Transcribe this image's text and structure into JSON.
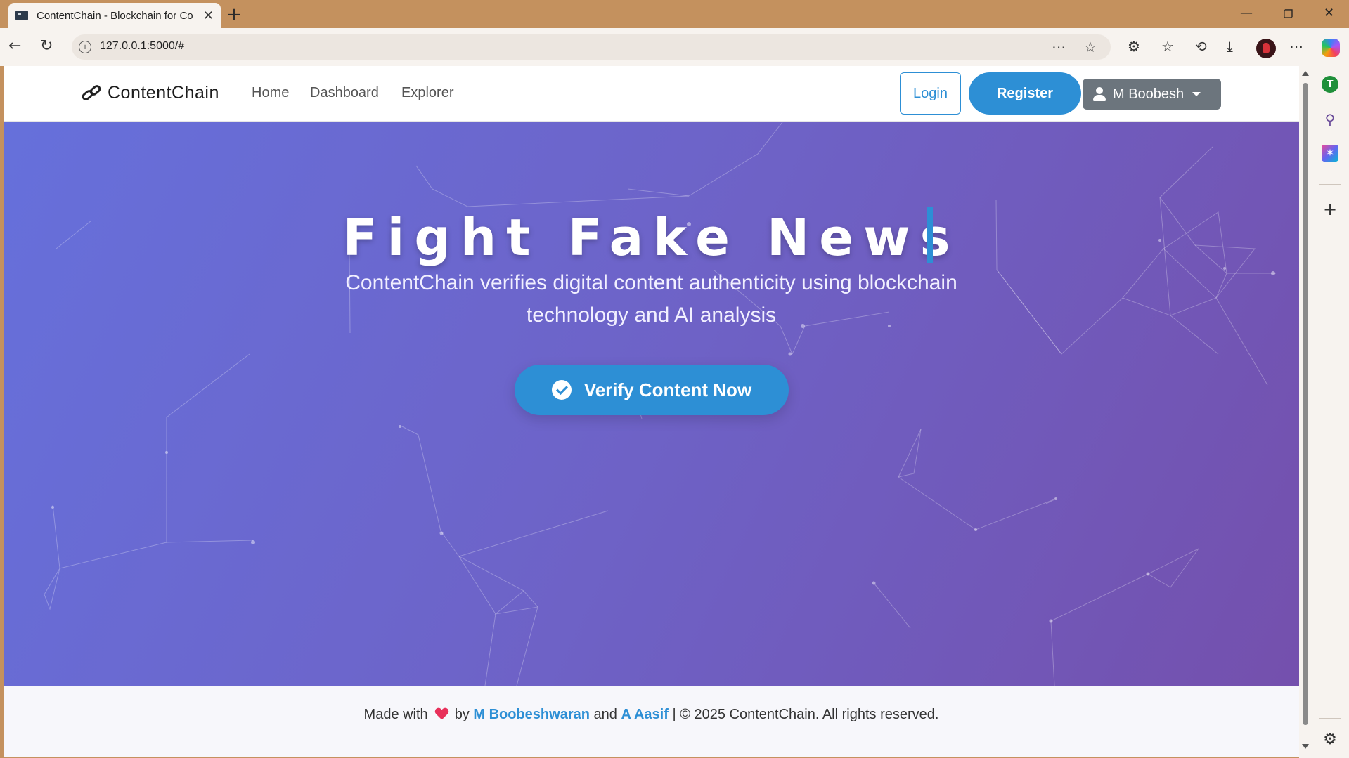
{
  "browser": {
    "tab_title": "ContentChain - Blockchain for Co",
    "url": "127.0.0.1:5000/#"
  },
  "site": {
    "brand": "ContentChain",
    "nav": [
      "Home",
      "Dashboard",
      "Explorer"
    ],
    "login_label": "Login",
    "register_label": "Register",
    "user_label": "M Boobesh"
  },
  "hero": {
    "title": "Fight Fake News",
    "subtitle_line1": "ContentChain verifies digital content authenticity using blockchain",
    "subtitle_line2": "technology and AI analysis",
    "cta_label": "Verify Content Now"
  },
  "footer": {
    "made_with": "Made with",
    "by": "by",
    "author1": "M Boobeshwaran",
    "and": "and",
    "author2": "A Aasif",
    "copyright": "| © 2025 ContentChain. All rights reserved."
  },
  "sidebar": {
    "profile_initial": "T"
  },
  "colors": {
    "primary": "#2d8fd5",
    "hero_start": "#6670db",
    "hero_end": "#7450ad",
    "user_button": "#6c757d",
    "heart": "#e8305a"
  }
}
